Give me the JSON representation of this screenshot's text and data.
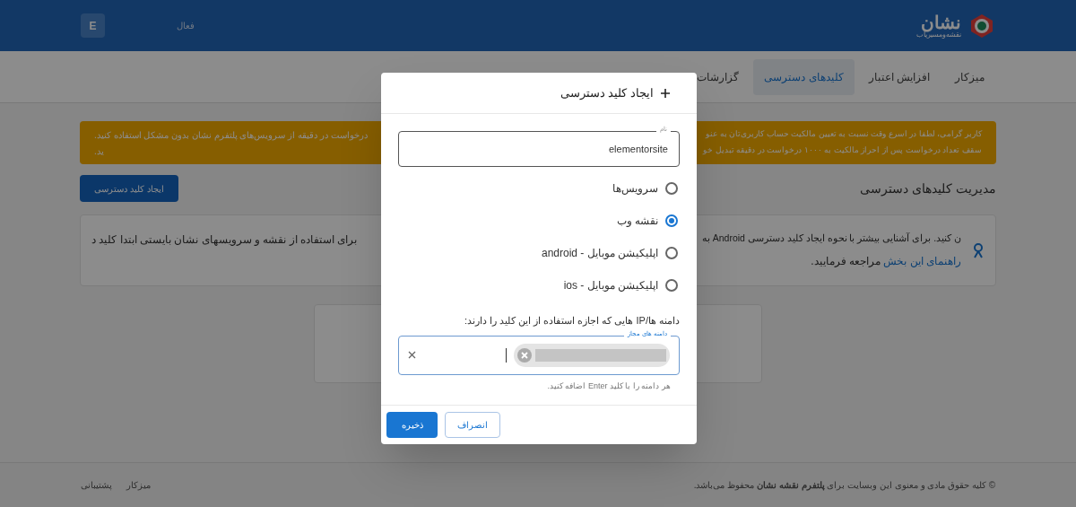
{
  "header": {
    "logo_title": "نشان",
    "logo_subtitle": "نقشه‌و‌مسیریاب",
    "avatar": "E",
    "status": "فعال"
  },
  "nav": [
    {
      "label": "میزکار",
      "selected": false
    },
    {
      "label": "افزایش اعتبار",
      "selected": false
    },
    {
      "label": "کلیدهای دسترسی",
      "selected": true
    },
    {
      "label": "گزارشات",
      "selected": false
    }
  ],
  "notice": {
    "lines": [
      {
        "right": "کاربر گرامی، لطفا در اسرع وقت نسبت به تعیین مالکیت حساب کاربری‌تان به عنو",
        "left": "درخواست در دقیقه از سرویس‌های پلتفرم نشان بدون مشکل استفاده کنید."
      },
      {
        "right": "سقف تعداد درخواست پس از احراز مالکیت به ۱۰۰۰ درخواست در دقیقه تبدیل خو",
        "left": "ید."
      }
    ]
  },
  "section_title": "مدیریت کلیدهای دسترسی",
  "create_button": "ایجاد کلید دسترسی",
  "info": {
    "line1_right": "ن کنید. برای آشنایی بیشتر با نحوه ایجاد کلید دسترسی Android به",
    "line1_left": "برای استفاده از نقشه و سرویسهای نشان بایستی ابتدا کلید د",
    "link": "راهنمای این بخش",
    "after_link": "مراجعه فرمایید."
  },
  "footer": {
    "copyright": "© کلیه حقوق مادی و معنوی این وبسایت برای **پلتفرم نقشه نشان** محفوظ می‌باشد.",
    "links": [
      "میزکار",
      "پشتیبانی"
    ]
  },
  "dialog": {
    "title": "ایجاد کلید دسترسی",
    "name_field": {
      "label": "نام",
      "value": "elementorsite"
    },
    "options": [
      {
        "label": "سرویس‌ها",
        "selected": false
      },
      {
        "label": "نقشه وب",
        "selected": true
      },
      {
        "label": "اپلیکیشن موبایل - android",
        "selected": false
      },
      {
        "label": "اپلیکیشن موبایل - ios",
        "selected": false
      }
    ],
    "domains_prompt": "دامنه ها/IP هایی که اجازه استفاده از این کلید را دارند:",
    "domains_field": {
      "label": "دامنه های مجاز",
      "chips": [
        {
          "kind": "redacted"
        }
      ]
    },
    "hint": "هر دامنه را با کلید Enter اضافه کنید.",
    "save": "ذخیره",
    "cancel": "انصراف"
  }
}
